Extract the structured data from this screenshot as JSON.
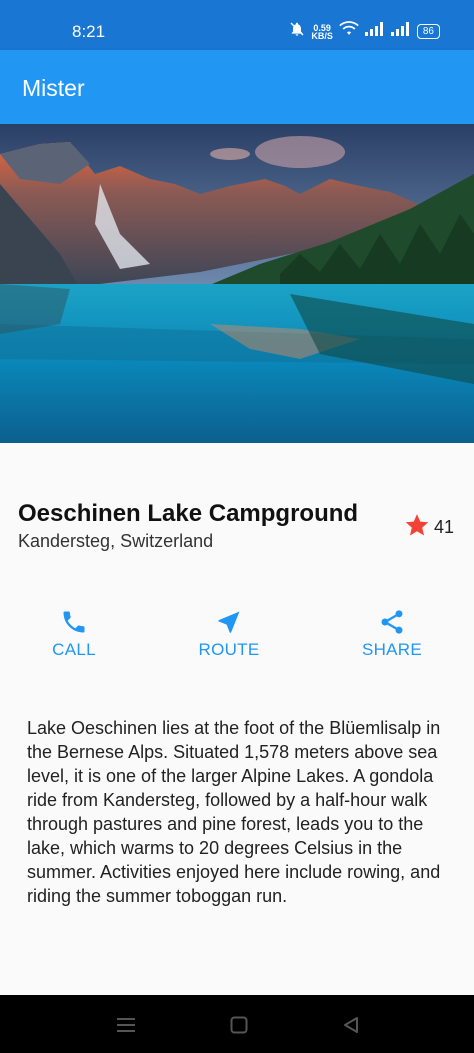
{
  "status_bar": {
    "time": "8:21",
    "net_speed_value": "0.59",
    "net_speed_unit": "KB/S",
    "battery": "86"
  },
  "app_bar": {
    "title": "Mister"
  },
  "place": {
    "title": "Oeschinen Lake Campground",
    "location": "Kandersteg, Switzerland",
    "favorite_count": "41"
  },
  "actions": [
    {
      "label": "CALL",
      "icon": "phone-icon"
    },
    {
      "label": "ROUTE",
      "icon": "navigation-arrow-icon"
    },
    {
      "label": "SHARE",
      "icon": "share-icon"
    }
  ],
  "description": "Lake Oeschinen lies at the foot of the Blüemlisalp in the Bernese Alps. Situated 1,578 meters above sea level, it is one of the larger Alpine Lakes. A gondola ride from Kandersteg, followed by a half-hour walk through pastures and pine forest, leads you to the lake, which warms to 20 degrees Celsius in the summer. Activities enjoyed here include rowing, and riding the summer toboggan run.",
  "colors": {
    "status_bar": "#1976d2",
    "app_bar": "#2196f3",
    "accent": "#2196f3",
    "star": "#f44336"
  }
}
